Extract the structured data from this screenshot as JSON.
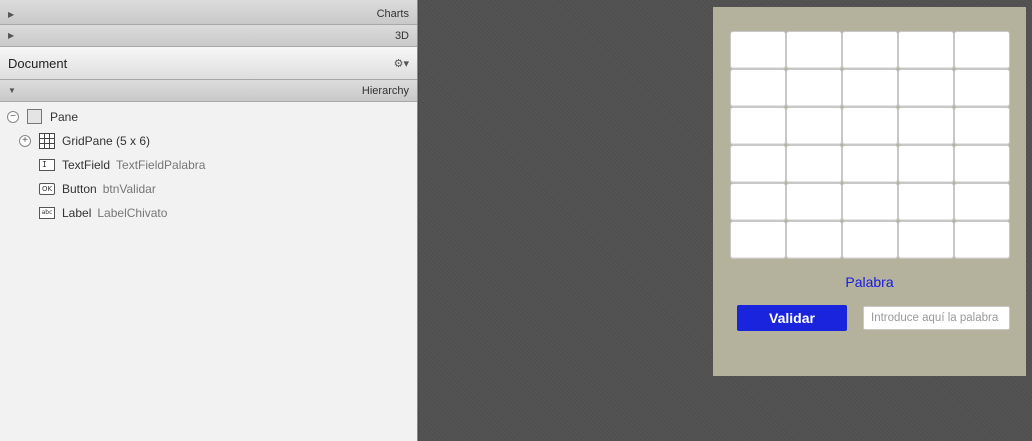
{
  "sections": {
    "charts": "Charts",
    "three_d": "3D",
    "document": "Document",
    "hierarchy": "Hierarchy"
  },
  "tree": {
    "pane": {
      "type": "Pane"
    },
    "gridpane": {
      "type": "GridPane (5 x 6)"
    },
    "textfield": {
      "type": "TextField",
      "id": "TextFieldPalabra"
    },
    "button": {
      "type": "Button",
      "id": "btnValidar"
    },
    "label": {
      "type": "Label",
      "id": "LabelChivato"
    }
  },
  "icons": {
    "textfield": "I",
    "button": "OK",
    "label": "abc",
    "expand": "⊕",
    "collapse": "⊖",
    "gear": "⚙▾"
  },
  "canvas": {
    "grid_columns": 5,
    "grid_rows": 6,
    "word_label": "Palabra",
    "validate_button": "Validar",
    "input_placeholder": "Introduce aquí la palabra"
  },
  "colors": {
    "pane_bg": "#b4b29c",
    "accent_blue": "#1a24dd",
    "label_blue": "#1a1ae0"
  }
}
